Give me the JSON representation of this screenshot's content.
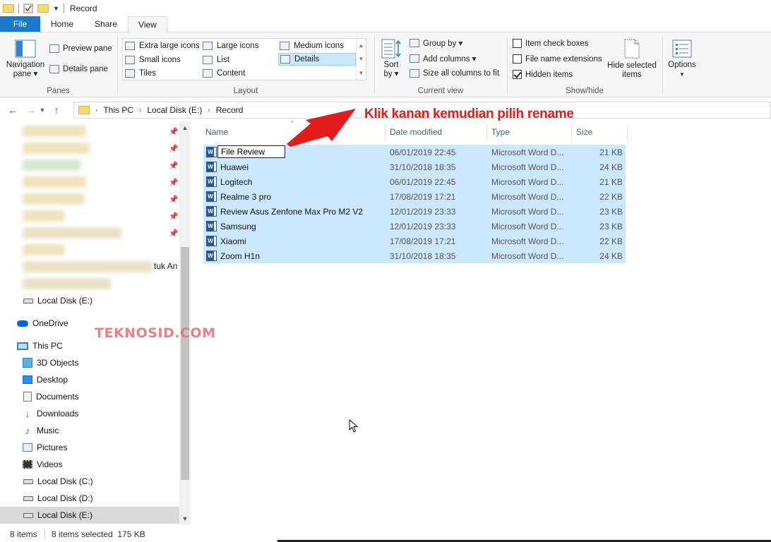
{
  "window": {
    "title": "Record"
  },
  "tabs": [
    "File",
    "Home",
    "Share",
    "View"
  ],
  "ribbon": {
    "panes": {
      "navigation_pane_line1": "Navigation",
      "navigation_pane_line2": "pane ▾",
      "preview_pane": "Preview pane",
      "details_pane": "Details pane",
      "label": "Panes"
    },
    "layout": {
      "extra_large_icons": "Extra large icons",
      "large_icons": "Large icons",
      "medium_icons": "Medium icons",
      "small_icons": "Small icons",
      "list": "List",
      "details": "Details",
      "tiles": "Tiles",
      "content": "Content",
      "label": "Layout"
    },
    "current_view": {
      "sort_line1": "Sort",
      "sort_line2": "by ▾",
      "group_by": "Group by ▾",
      "add_columns": "Add columns ▾",
      "size_all_columns": "Size all columns to fit",
      "label": "Current view"
    },
    "show_hide": {
      "item_check_boxes": "Item check boxes",
      "file_name_extensions": "File name extensions",
      "hidden_items": "Hidden items",
      "hide_selected_line1": "Hide selected",
      "hide_selected_line2": "items",
      "label": "Show/hide"
    },
    "options": {
      "label": "Options",
      "caret": "▾"
    }
  },
  "breadcrumb": [
    "This PC",
    "Local Disk (E:)",
    "Record"
  ],
  "nav_pane": {
    "partial_text": "tuk An",
    "items": [
      {
        "label": "Local Disk (E:)",
        "icon": "drive-icon"
      },
      {
        "label": "OneDrive",
        "icon": "onedrive-icon"
      },
      {
        "label": "This PC",
        "icon": "this-pc-icon"
      },
      {
        "label": "3D Objects",
        "icon": "3d-objects-icon"
      },
      {
        "label": "Desktop",
        "icon": "desktop-icon"
      },
      {
        "label": "Documents",
        "icon": "documents-icon"
      },
      {
        "label": "Downloads",
        "icon": "downloads-icon"
      },
      {
        "label": "Music",
        "icon": "music-icon"
      },
      {
        "label": "Pictures",
        "icon": "pictures-icon"
      },
      {
        "label": "Videos",
        "icon": "videos-icon"
      },
      {
        "label": "Local Disk (C:)",
        "icon": "drive-icon"
      },
      {
        "label": "Local Disk (D:)",
        "icon": "drive-icon"
      },
      {
        "label": "Local Disk (E:)",
        "icon": "drive-icon"
      }
    ]
  },
  "columns": {
    "name": "Name",
    "date": "Date modified",
    "type": "Type",
    "size": "Size"
  },
  "rename_value": "File Review",
  "files": [
    {
      "name": "File Review",
      "date": "06/01/2019 22:45",
      "type": "Microsoft Word D...",
      "size": "21 KB"
    },
    {
      "name": "Huawei",
      "date": "31/10/2018 18:35",
      "type": "Microsoft Word D...",
      "size": "24 KB"
    },
    {
      "name": "Logitech",
      "date": "06/01/2019 22:45",
      "type": "Microsoft Word D...",
      "size": "21 KB"
    },
    {
      "name": "Realme 3 pro",
      "date": "17/08/2019 17:21",
      "type": "Microsoft Word D...",
      "size": "22 KB"
    },
    {
      "name": "Review Asus Zenfone Max Pro M2 V2",
      "date": "12/01/2019 23:33",
      "type": "Microsoft Word D...",
      "size": "23 KB"
    },
    {
      "name": "Samsung",
      "date": "12/01/2019 23:33",
      "type": "Microsoft Word D...",
      "size": "23 KB"
    },
    {
      "name": "Xiaomi",
      "date": "17/08/2019 17:21",
      "type": "Microsoft Word D...",
      "size": "22 KB"
    },
    {
      "name": "Zoom H1n",
      "date": "31/10/2018 18:35",
      "type": "Microsoft Word D...",
      "size": "24 KB"
    }
  ],
  "status": {
    "items": "8 items",
    "selected": "8 items selected  175 KB"
  },
  "annotation": {
    "text": "Klik kanan kemudian pilih rename",
    "color": "#e51b1b"
  },
  "watermark": "TEKNOSID.COM",
  "colors": {
    "selection": "#cce8ff",
    "file_tab": "#1979ca"
  }
}
